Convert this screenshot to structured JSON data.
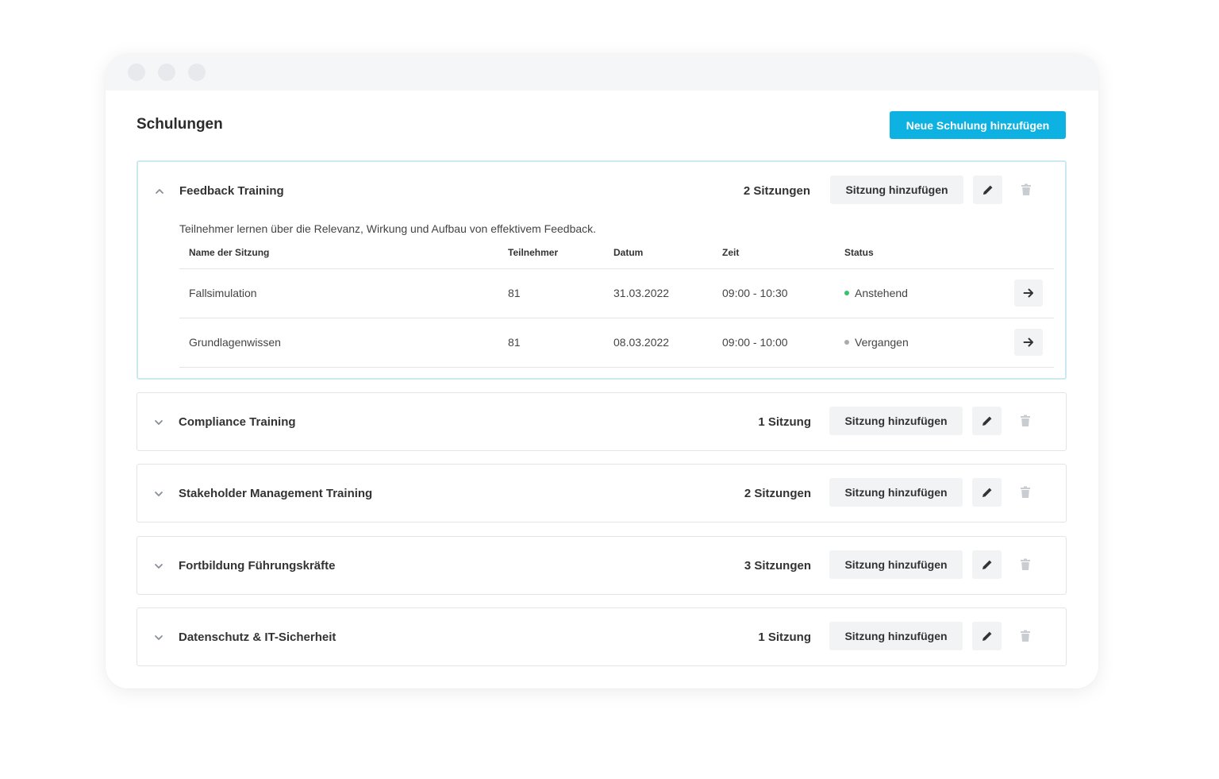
{
  "colors": {
    "primary": "#0db2e3",
    "upcoming": "#35c26a",
    "past": "#a7abb0",
    "delete_icon": "#c9ccd0",
    "edit_icon": "#333333"
  },
  "page": {
    "title": "Schulungen",
    "new_training_label": "Neue Schulung hinzufügen"
  },
  "common": {
    "add_session_label": "Sitzung hinzufügen"
  },
  "table_headers": {
    "name": "Name der Sitzung",
    "participants": "Teilnehmer",
    "date": "Datum",
    "time": "Zeit",
    "status": "Status"
  },
  "trainings": [
    {
      "title": "Feedback Training",
      "sessions_label": "2 Sitzungen",
      "expanded": true,
      "description": "Teilnehmer lernen über die Relevanz, Wirkung und Aufbau von effektivem Feedback.",
      "sessions": [
        {
          "name": "Fallsimulation",
          "participants": "81",
          "date": "31.03.2022",
          "time": "09:00 - 10:30",
          "status": "Anstehend",
          "status_color": "#35c26a"
        },
        {
          "name": "Grundlagenwissen",
          "participants": "81",
          "date": "08.03.2022",
          "time": "09:00 - 10:00",
          "status": "Vergangen",
          "status_color": "#a7abb0"
        }
      ]
    },
    {
      "title": "Compliance Training",
      "sessions_label": "1 Sitzung",
      "expanded": false
    },
    {
      "title": "Stakeholder Management Training",
      "sessions_label": "2 Sitzungen",
      "expanded": false
    },
    {
      "title": "Fortbildung Führungskräfte",
      "sessions_label": "3 Sitzungen",
      "expanded": false
    },
    {
      "title": "Datenschutz & IT-Sicherheit",
      "sessions_label": "1 Sitzung",
      "expanded": false
    }
  ]
}
